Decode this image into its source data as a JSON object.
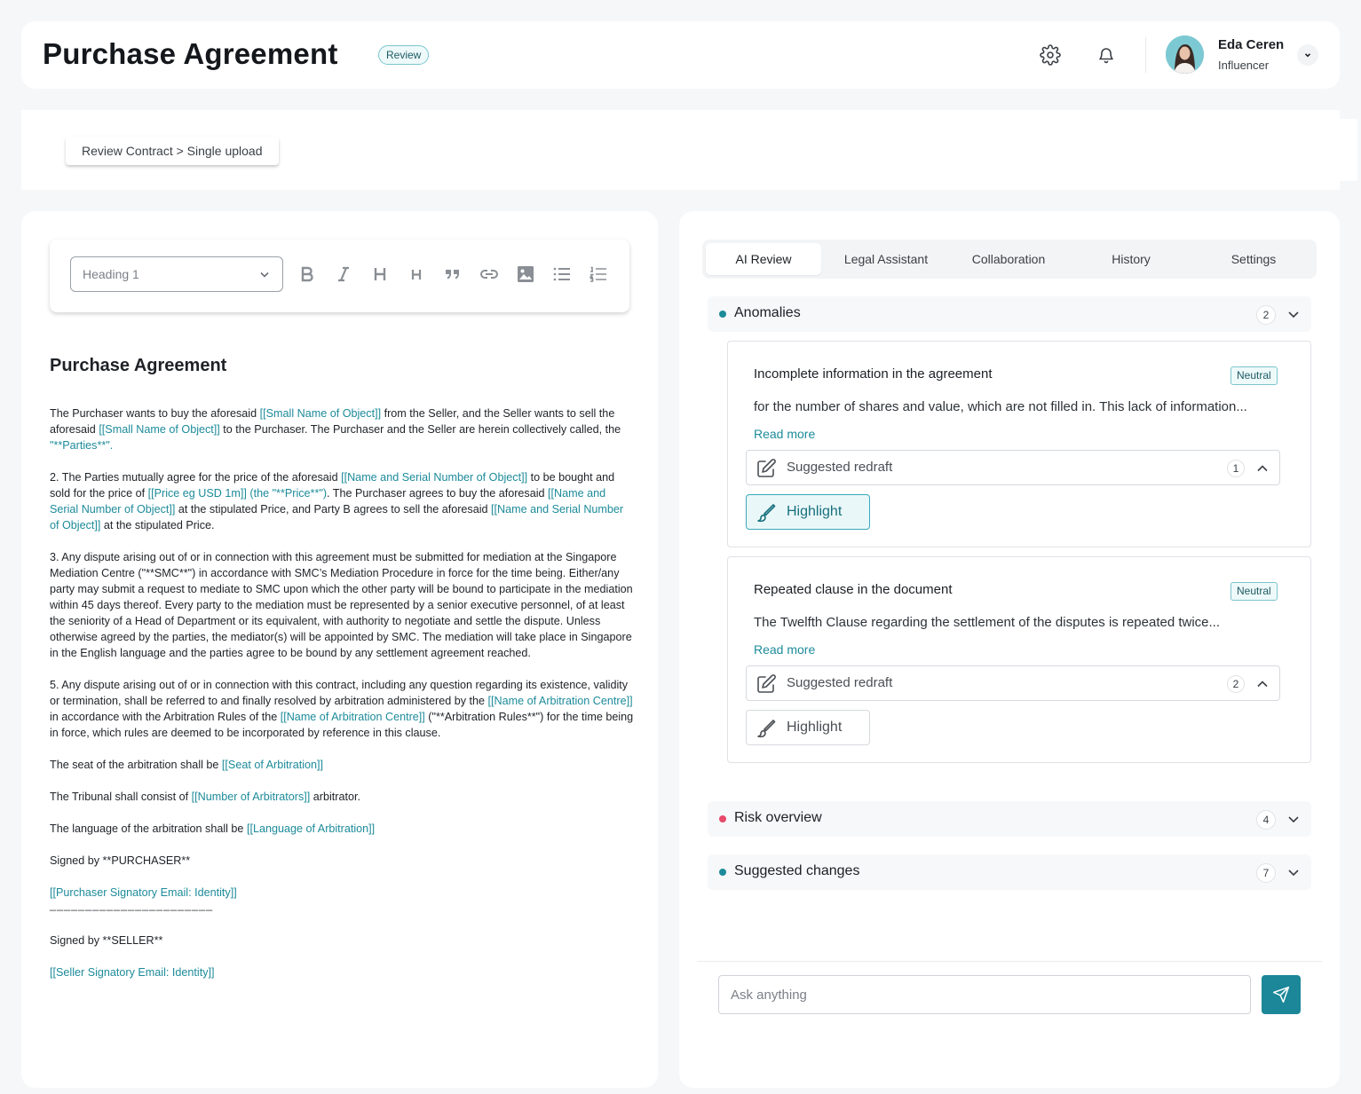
{
  "header": {
    "title": "Purchase Agreement",
    "status": "Review",
    "user": {
      "name": "Eda Ceren",
      "role": "Influencer"
    }
  },
  "breadcrumb": "Review Contract > Single upload",
  "editor": {
    "heading_select": "Heading 1",
    "toolbar_buttons": [
      "bold-icon",
      "italic-icon",
      "heading-large-icon",
      "heading-small-icon",
      "quote-icon",
      "link-icon",
      "image-icon",
      "bullet-list-icon",
      "numbered-list-icon"
    ],
    "doc_title": "Purchase Agreement",
    "p1": {
      "t1": "The Purchaser wants to buy the aforesaid ",
      "ph1": "[[Small Name of Object]]",
      "t2": " from the Seller, and the Seller wants to sell the aforesaid ",
      "ph2": "[[Small Name of Object]]",
      "t3": " to the Purchaser. The Purchaser and the Seller are herein collectively called, the ",
      "ph3": "\"**Parties**\".",
      "t4": ""
    },
    "p2": {
      "t1": "2.  The Parties mutually agree for the price of the aforesaid ",
      "ph1": "[[Name and Serial Number of Object]]",
      "t2": " to be bought and sold for the price of ",
      "ph2": "[[Price eg USD 1m]] (the \"**Price**\")",
      "t3": ". The Purchaser agrees to buy the aforesaid ",
      "ph3": "[[Name and Serial Number of Object]]",
      "t4": " at the stipulated Price, and Party B agrees to sell the aforesaid ",
      "ph4": "[[Name and Serial Number of Object]]",
      "t5": " at the stipulated Price."
    },
    "p3": "3.  Any dispute arising out of or in connection with this agreement must be submitted for mediation at the Singapore Mediation Centre (\"**SMC**\") in accordance with SMC’s Mediation Procedure in force for the time being. Either/any party may submit a request to mediate to SMC upon which the other party will be bound to participate in the mediation within 45 days thereof. Every party to the mediation must be represented by a senior executive personnel, of at least the seniority of a Head of Department or its equivalent, with authority to negotiate and settle the dispute. Unless otherwise agreed by the parties, the mediator(s) will be appointed by SMC. The mediation will take place in Singapore in the English language and the parties agree to be bound by any settlement agreement reached.",
    "p5": {
      "t1": "5.  Any dispute arising out of or in connection with this contract, including any question regarding its existence, validity or termination, shall be referred to and finally resolved by arbitration administered by the ",
      "ph1": "[[Name of Arbitration Centre]]",
      "t2": " in accordance with the Arbitration Rules of the ",
      "ph2": "[[Name of Arbitration Centre]]",
      "t3": " (\"**Arbitration Rules**\") for the time being in force, which rules are deemed to be incorporated by reference in this clause."
    },
    "seat": {
      "t1": "The seat of the arbitration shall be ",
      "ph1": "[[Seat of Arbitration]]"
    },
    "tribunal": {
      "t1": "The Tribunal shall consist of ",
      "ph1": "[[Number of Arbitrators]]",
      "t2": " arbitrator."
    },
    "language": {
      "t1": "The language of the arbitration shall be ",
      "ph1": "[[Language of Arbitration]]"
    },
    "signed_purchaser": "Signed by **PURCHASER**",
    "purchaser_email": "[[Purchaser Signatory Email: Identity]]",
    "sign_line": "_______________________",
    "signed_seller": "Signed by **SELLER**",
    "seller_email": "[[Seller Signatory Email: Identity]]"
  },
  "review": {
    "tabs": [
      "AI Review",
      "Legal Assistant",
      "Collaboration",
      "History",
      "Settings"
    ],
    "active_tab": "AI Review",
    "sections": [
      {
        "label": "Anomalies",
        "count": "2",
        "dot_color": "#1d8b9a"
      },
      {
        "label": "Risk overview",
        "count": "4",
        "dot_color": "#e84a6a"
      },
      {
        "label": "Suggested changes",
        "count": "7",
        "dot_color": "#1d8b9a"
      }
    ],
    "anomalies": [
      {
        "title": "Incomplete information in the agreement",
        "badge": "Neutral",
        "description": "for the number of shares and value, which are not filled in. This lack of information...",
        "read_more": "Read more",
        "redraft_label": "Suggested redraft",
        "redraft_count": "1",
        "highlight_label": "Highlight"
      },
      {
        "title": "Repeated clause in the document",
        "badge": "Neutral",
        "description": "The Twelfth Clause regarding the settlement of the disputes is repeated twice...",
        "read_more": "Read more",
        "redraft_label": "Suggested redraft",
        "redraft_count": "2",
        "highlight_label": "Highlight"
      }
    ],
    "chat": {
      "placeholder": "Ask anything"
    }
  },
  "colors": {
    "accent": "#1b8798",
    "placeholder_text": "#1d8b9a",
    "risk": "#e84a6a"
  }
}
